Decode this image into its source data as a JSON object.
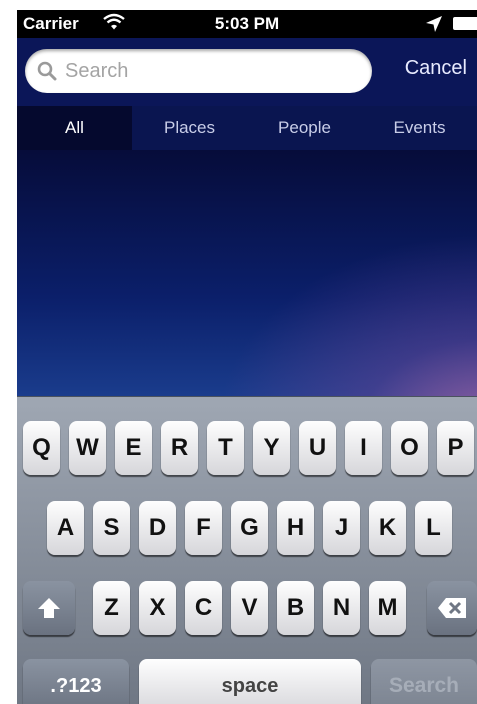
{
  "status_bar": {
    "carrier": "Carrier",
    "time": "5:03 PM"
  },
  "search_bar": {
    "placeholder": "Search",
    "value": "",
    "cancel_label": "Cancel"
  },
  "tabs": [
    {
      "label": "All",
      "active": true
    },
    {
      "label": "Places",
      "active": false
    },
    {
      "label": "People",
      "active": false
    },
    {
      "label": "Events",
      "active": false
    }
  ],
  "keyboard": {
    "row1": [
      "Q",
      "W",
      "E",
      "R",
      "T",
      "Y",
      "U",
      "I",
      "O",
      "P"
    ],
    "row2": [
      "A",
      "S",
      "D",
      "F",
      "G",
      "H",
      "J",
      "K",
      "L"
    ],
    "row3": [
      "Z",
      "X",
      "C",
      "V",
      "B",
      "N",
      "M"
    ],
    "numbers_label": ".?123",
    "space_label": "space",
    "search_label": "Search",
    "shift_icon": "shift-icon",
    "backspace_icon": "backspace-icon"
  },
  "colors": {
    "nav_background": "#0b1658",
    "content_background": "#0b1f6a",
    "keyboard_background": "#7e8692"
  }
}
